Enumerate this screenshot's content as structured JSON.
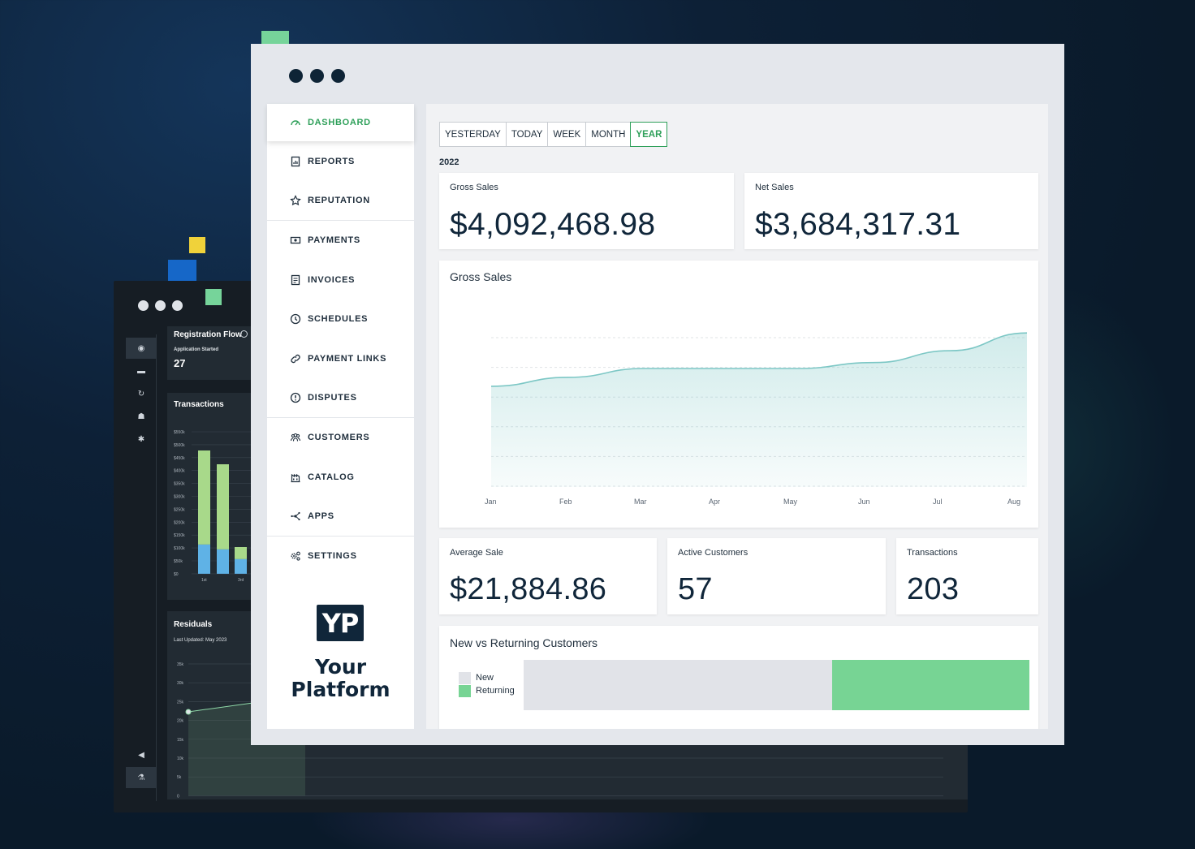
{
  "back_window": {
    "registration": {
      "title": "Registration Flow",
      "subtitle": "Application Started",
      "value": "27"
    },
    "transactions": {
      "title": "Transactions",
      "y_ticks": [
        "$550k",
        "$500k",
        "$450k",
        "$400k",
        "$350k",
        "$300k",
        "$250k",
        "$200k",
        "$150k",
        "$100k",
        "$50k",
        "$0"
      ],
      "x_ticks": [
        "1st",
        "3rd"
      ]
    },
    "residuals": {
      "title": "Residuals",
      "subtitle": "Last Updated: May 2023",
      "y_ticks": [
        "35k",
        "30k",
        "25k",
        "20k",
        "15k",
        "10k",
        "5k",
        "0"
      ]
    }
  },
  "sidebar": {
    "items": [
      {
        "label": "DASHBOARD",
        "icon": "gauge-icon",
        "active": true
      },
      {
        "label": "REPORTS",
        "icon": "report-icon"
      },
      {
        "label": "REPUTATION",
        "icon": "star-icon"
      },
      {
        "label": "PAYMENTS",
        "icon": "cash-icon"
      },
      {
        "label": "INVOICES",
        "icon": "invoice-icon"
      },
      {
        "label": "SCHEDULES",
        "icon": "clock-icon"
      },
      {
        "label": "PAYMENT LINKS",
        "icon": "link-icon"
      },
      {
        "label": "DISPUTES",
        "icon": "alert-icon"
      },
      {
        "label": "CUSTOMERS",
        "icon": "people-icon"
      },
      {
        "label": "CATALOG",
        "icon": "catalog-icon"
      },
      {
        "label": "APPS",
        "icon": "apps-icon"
      },
      {
        "label": "SETTINGS",
        "icon": "gear-icon"
      }
    ],
    "logo_mark": "YP",
    "logo_line1": "Your",
    "logo_line2": "Platform"
  },
  "filters": [
    "YESTERDAY",
    "TODAY",
    "WEEK",
    "MONTH",
    "YEAR"
  ],
  "active_filter": "YEAR",
  "year": "2022",
  "kpis": {
    "gross_sales": {
      "label": "Gross Sales",
      "value": "$4,092,468.98"
    },
    "net_sales": {
      "label": "Net Sales",
      "value": "$3,684,317.31"
    },
    "average_sale": {
      "label": "Average Sale",
      "value": "$21,884.86"
    },
    "active_customers": {
      "label": "Active Customers",
      "value": "57"
    },
    "transactions": {
      "label": "Transactions",
      "value": "203"
    }
  },
  "chart_data": [
    {
      "type": "area",
      "title": "Gross Sales",
      "categories": [
        "Jan",
        "Feb",
        "Mar",
        "Apr",
        "May",
        "Jun",
        "Jul",
        "Aug"
      ],
      "values": [
        0.34,
        0.37,
        0.4,
        0.4,
        0.4,
        0.42,
        0.46,
        0.52
      ],
      "ylim": [
        0,
        0.6
      ],
      "grid": true,
      "color": "#7cc7c5"
    },
    {
      "type": "bar",
      "title": "New vs Returning Customers",
      "series": [
        {
          "name": "New",
          "value": 0.61,
          "color": "#e1e3e8"
        },
        {
          "name": "Returning",
          "value": 0.39,
          "color": "#77d494"
        }
      ]
    }
  ]
}
